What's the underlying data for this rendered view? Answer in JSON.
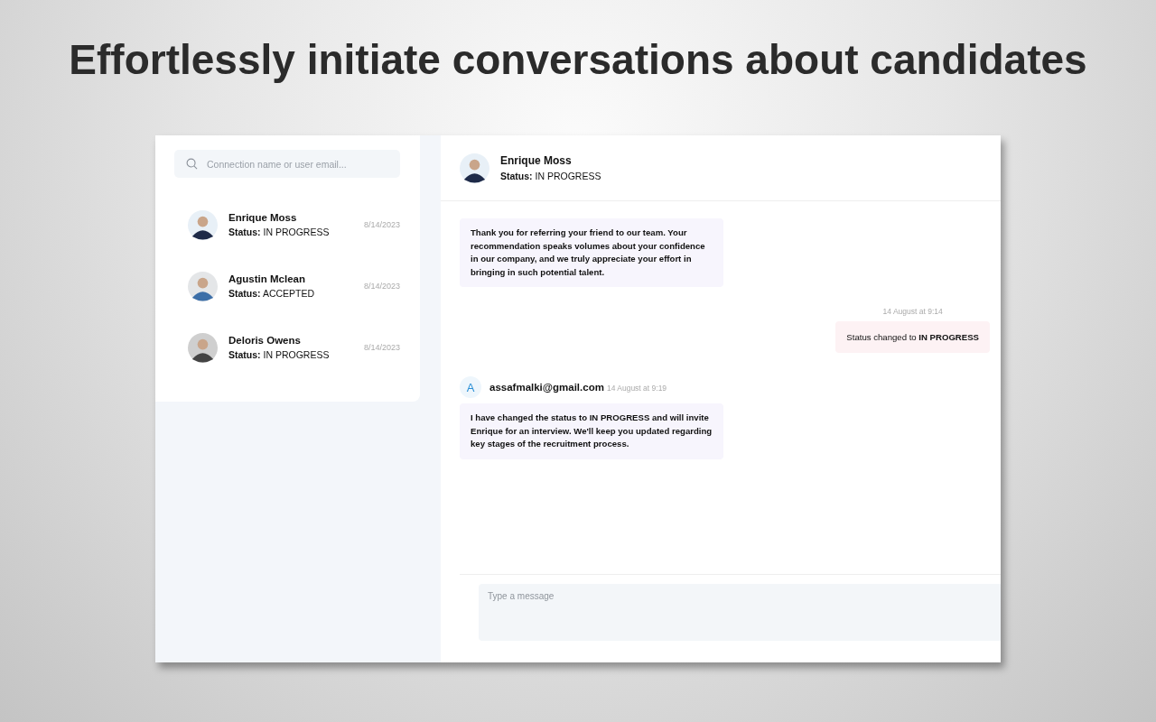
{
  "headline": "Effortlessly initiate conversations about candidates",
  "search": {
    "placeholder": "Connection name or user email..."
  },
  "contacts": [
    {
      "name": "Enrique Moss",
      "status": "**Status:** IN PROGRESS",
      "date": "8/14/2023"
    },
    {
      "name": "Agustin Mclean",
      "status": "**Status:** ACCEPTED",
      "date": "8/14/2023"
    },
    {
      "name": "Deloris Owens",
      "status": "**Status:** IN PROGRESS",
      "date": "8/14/2023"
    }
  ],
  "chat_header": {
    "name": "Enrique Moss",
    "status": "**Status:** IN PROGRESS"
  },
  "messages": [
    {
      "kind": "incoming",
      "text": "Thank you for referring your friend to our team. Your recommendation speaks volumes about your confidence in our company, and we truly appreciate your effort in bringing in such potential talent."
    },
    {
      "kind": "status",
      "time": "14 August at 9:14",
      "text": "Status changed to **IN PROGRESS**"
    },
    {
      "kind": "user",
      "initial": "A",
      "author": "assafmalki@gmail.com",
      "time": "14 August at 9:19",
      "text": "I have changed the status to IN PROGRESS and will invite Enrique for an interview. We'll keep you updated regarding key stages of the recruitment process."
    }
  ],
  "composer": {
    "placeholder": "Type a message"
  }
}
